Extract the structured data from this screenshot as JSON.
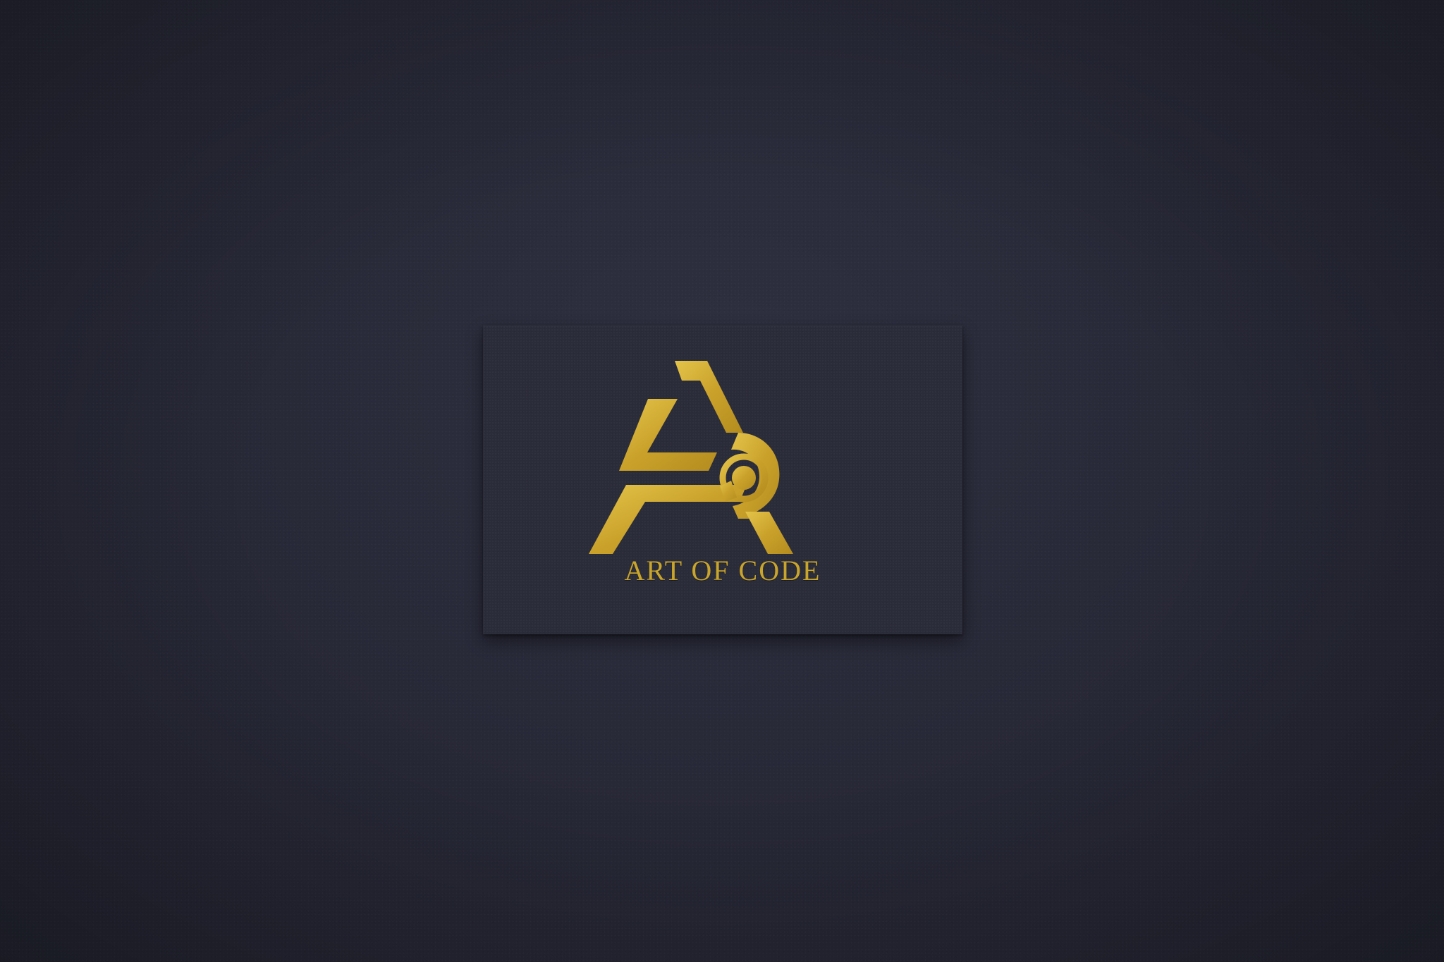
{
  "scene": {
    "background_color": "#272836",
    "card_color": "#2b2c39",
    "gold_color": "#c9a52c"
  },
  "card": {
    "logo_icon": "art-of-code-monogram",
    "brand_name": "ART OF CODE"
  }
}
